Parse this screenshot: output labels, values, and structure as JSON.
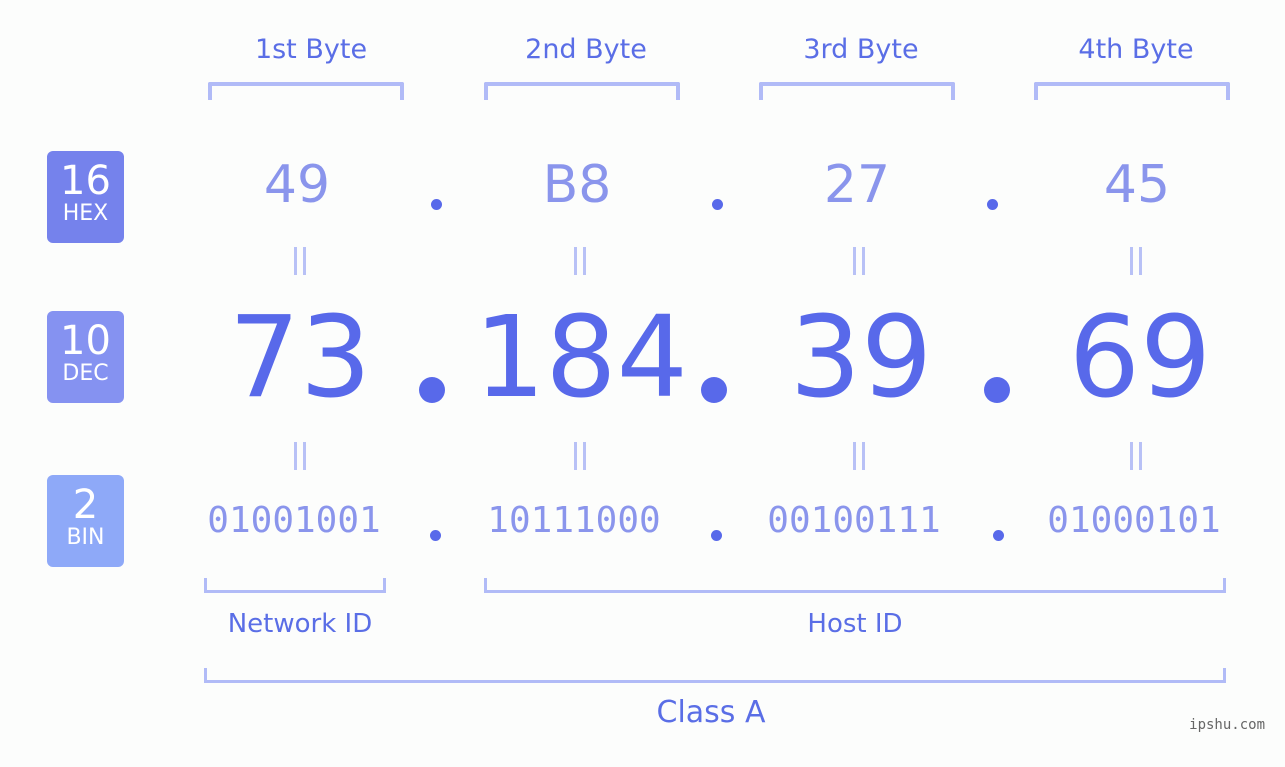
{
  "bytes": {
    "labels": [
      "1st Byte",
      "2nd Byte",
      "3rd Byte",
      "4th Byte"
    ]
  },
  "rows": {
    "hex": {
      "base": "16",
      "name": "HEX",
      "values": [
        "49",
        "B8",
        "27",
        "45"
      ],
      "color": "#7582ec"
    },
    "dec": {
      "base": "10",
      "name": "DEC",
      "values": [
        "73",
        "184",
        "39",
        "69"
      ],
      "color": "#8592f1"
    },
    "bin": {
      "base": "2",
      "name": "BIN",
      "values": [
        "01001001",
        "10111000",
        "00100111",
        "01000101"
      ],
      "color": "#8ea9f8"
    }
  },
  "segments": {
    "network": "Network ID",
    "host": "Host ID",
    "class": "Class A"
  },
  "watermark": "ipshu.com"
}
